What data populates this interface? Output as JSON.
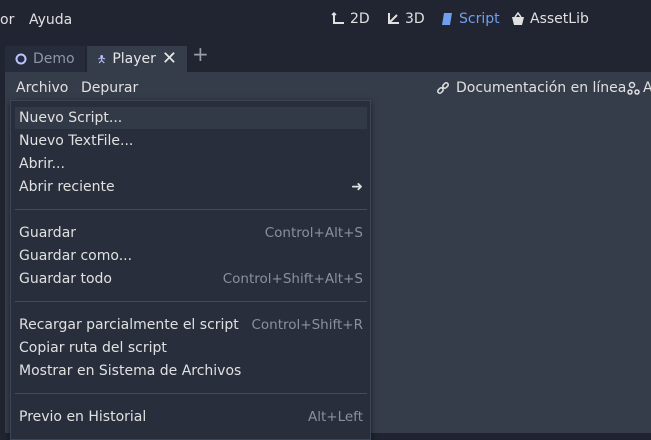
{
  "top_menu": {
    "editor_partial": "or",
    "help": "Ayuda"
  },
  "modes": [
    {
      "label": "2D",
      "icon": "2d-icon"
    },
    {
      "label": "3D",
      "icon": "3d-icon"
    },
    {
      "label": "Script",
      "icon": "script-icon"
    },
    {
      "label": "AssetLib",
      "icon": "assetlib-icon"
    }
  ],
  "tabs": [
    {
      "label": "Demo",
      "icon": "scene-circle-icon"
    },
    {
      "label": "Player",
      "icon": "player-node-icon",
      "close": "✕"
    }
  ],
  "tab_add": "+",
  "script_menu": {
    "file": "Archivo",
    "debug": "Depurar"
  },
  "doc_link": "Documentación en línea",
  "extra_partial": "A",
  "file_menu": {
    "items": [
      {
        "label": "Nuevo Script...",
        "shortcut": ""
      },
      {
        "label": "Nuevo TextFile...",
        "shortcut": ""
      },
      {
        "label": "Abrir...",
        "shortcut": ""
      },
      {
        "label": "Abrir reciente",
        "shortcut": ""
      },
      {
        "label": "Guardar",
        "shortcut": "Control+Alt+S"
      },
      {
        "label": "Guardar como...",
        "shortcut": ""
      },
      {
        "label": "Guardar todo",
        "shortcut": "Control+Shift+Alt+S"
      },
      {
        "label": "Recargar parcialmente el script",
        "shortcut": "Control+Shift+R"
      },
      {
        "label": "Copiar ruta del script",
        "shortcut": ""
      },
      {
        "label": "Mostrar en Sistema de Archivos",
        "shortcut": ""
      },
      {
        "label": "Previo en Historial",
        "shortcut": "Alt+Left"
      }
    ]
  },
  "colors": {
    "accent": "#6fa0ef",
    "background": "#1f2430",
    "panel": "#363d4a",
    "menu": "#282e3b"
  }
}
